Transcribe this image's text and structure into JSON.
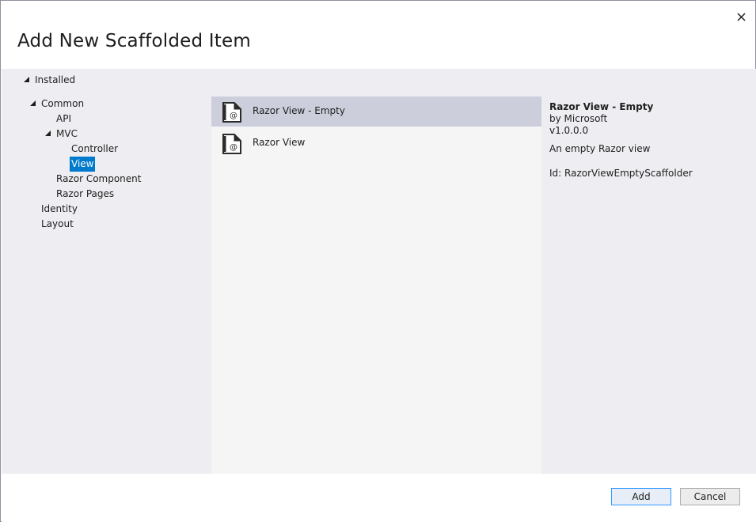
{
  "dialog": {
    "title": "Add New Scaffolded Item",
    "close_glyph": "✕"
  },
  "tree": {
    "installed": "Installed",
    "common": "Common",
    "api": "API",
    "mvc": "MVC",
    "controller": "Controller",
    "view": "View",
    "razor_component": "Razor Component",
    "razor_pages": "Razor Pages",
    "identity": "Identity",
    "layout": "Layout"
  },
  "templates": [
    {
      "label": "Razor View - Empty",
      "icon": "razor-file-icon",
      "selected": true
    },
    {
      "label": "Razor View",
      "icon": "razor-file-icon",
      "selected": false
    }
  ],
  "details": {
    "name": "Razor View - Empty",
    "author": "by Microsoft",
    "version": "v1.0.0.0",
    "description": "An empty Razor view",
    "id": "Id: RazorViewEmptyScaffolder"
  },
  "buttons": {
    "add": "Add",
    "cancel": "Cancel"
  },
  "colors": {
    "selection_accent": "#007acc",
    "selected_list_item": "#cccedb",
    "content_background": "#eeeef2"
  }
}
